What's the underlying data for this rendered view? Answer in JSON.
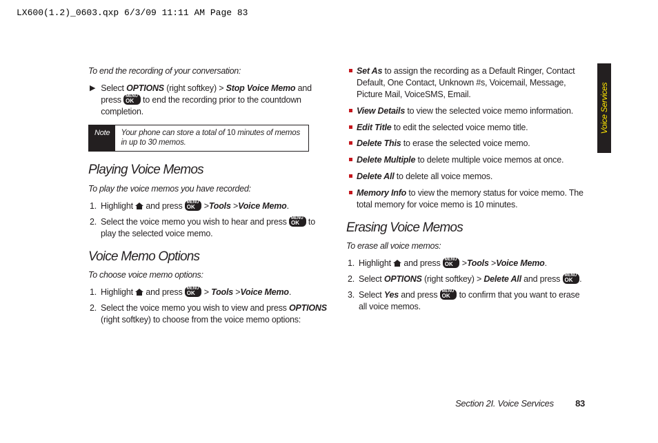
{
  "header_line": "LX600(1.2)_0603.qxp  6/3/09  11:11 AM  Page 83",
  "side_tab": "Voice Services",
  "footer": {
    "section": "Section 2I. Voice Services",
    "page": "83"
  },
  "left": {
    "intro1": "To end the recording of your conversation:",
    "step1_a": "Select ",
    "step1_opt": "OPTIONS",
    "step1_b": " (right softkey) ",
    "step1_gt": ">",
    "step1_svm": " Stop Voice Memo",
    "step1_c": " and press ",
    "step1_d": " to end the recording prior to the countdown completion.",
    "note_label": "Note",
    "note_a": "Your phone can store a total of ",
    "note_ten": "10",
    "note_b": " minutes of memos in up to 30 memos.",
    "h_play": "Playing Voice Memos",
    "intro2": "To play the voice memos you have recorded:",
    "p1_a": "Highlight ",
    "p1_b": " and press ",
    "p1_c": " >",
    "p1_tools": "Tools",
    "p1_gt2": " >",
    "p1_vm": "Voice Memo",
    "p1_dot": ".",
    "p2": "Select the voice memo you wish to hear and press ",
    "p2_b": " to play the selected voice memo.",
    "h_opt": "Voice Memo Options",
    "intro3": "To choose voice memo options:",
    "o1_a": "Highlight ",
    "o1_b": " and press ",
    "o1_c": " > ",
    "o1_tools": "Tools",
    "o1_gt2": " >",
    "o1_vm": "Voice Memo",
    "o1_dot": ".",
    "o2_a": "Select the voice memo you wish to view and press ",
    "o2_opt": "OPTIONS",
    "o2_b": " (right softkey) to choose from the voice memo options:"
  },
  "right": {
    "b1_t": "Set As",
    "b1_b": " to assign the recording as a Default Ringer, Contact Default, One Contact, Unknown #s, Voicemail, Message, Picture Mail, VoiceSMS, Email.",
    "b2_t": "View Details",
    "b2_b": " to view the selected voice memo information.",
    "b3_t": "Edit Title",
    "b3_b": " to edit the selected voice memo title.",
    "b4_t": "Delete This",
    "b4_b": " to erase the selected voice memo.",
    "b5_t": "Delete Multiple",
    "b5_b": " to delete multiple voice memos at once.",
    "b6_t": "Delete All",
    "b6_b": " to delete all voice memos.",
    "b7_t": "Memory Info",
    "b7_b": " to view the memory status for voice memo. The total memory for voice memo is 10 minutes.",
    "h_erase": "Erasing Voice Memos",
    "intro4": "To erase all voice memos:",
    "e1_a": "Highlight ",
    "e1_b": " and press ",
    "e1_c": " >",
    "e1_tools": "Tools",
    "e1_gt2": " >",
    "e1_vm": "Voice Memo",
    "e1_dot": ".",
    "e2_a": "Select ",
    "e2_opt": "OPTIONS",
    "e2_b": " (right softkey) ",
    "e2_gt": ">",
    "e2_del": " Delete All",
    "e2_c": " and press ",
    "e2_d": ".",
    "e3_a": "Select ",
    "e3_yes": "Yes",
    "e3_b": " and press ",
    "e3_c": " to confirm that you want to erase all voice memos."
  }
}
